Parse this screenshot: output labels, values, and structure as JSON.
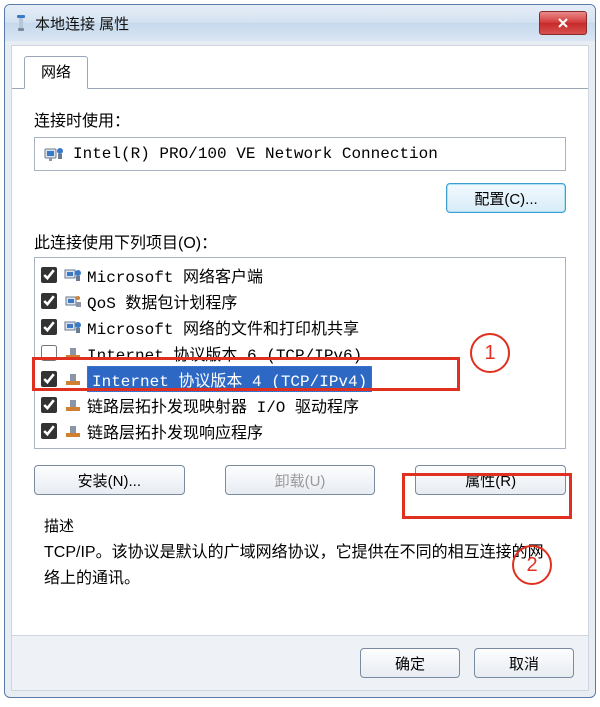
{
  "window": {
    "title": "本地连接 属性",
    "close_label": "X"
  },
  "tab": {
    "label": "网络"
  },
  "adapter": {
    "label": "连接时使用：",
    "name": "Intel(R) PRO/100 VE Network Connection",
    "configure_btn": "配置(C)..."
  },
  "items_label": "此连接使用下列项目(O)：",
  "items": [
    {
      "checked": true,
      "label": "Microsoft 网络客户端",
      "icon": "client-icon"
    },
    {
      "checked": true,
      "label": "QoS 数据包计划程序",
      "icon": "qos-icon"
    },
    {
      "checked": true,
      "label": "Microsoft 网络的文件和打印机共享",
      "icon": "share-icon"
    },
    {
      "checked": false,
      "label": "Internet 协议版本 6 (TCP/IPv6)",
      "icon": "protocol-icon"
    },
    {
      "checked": true,
      "label": "Internet 协议版本 4 (TCP/IPv4)",
      "icon": "protocol-icon",
      "selected": true
    },
    {
      "checked": true,
      "label": "链路层拓扑发现映射器 I/O 驱动程序",
      "icon": "protocol-icon"
    },
    {
      "checked": true,
      "label": "链路层拓扑发现响应程序",
      "icon": "protocol-icon"
    }
  ],
  "buttons": {
    "install": "安装(N)...",
    "uninstall": "卸载(U)",
    "properties": "属性(R)"
  },
  "description": {
    "legend": "描述",
    "text": "TCP/IP。该协议是默认的广域网络协议，它提供在不同的相互连接的网络上的通讯。"
  },
  "dialog_buttons": {
    "ok": "确定",
    "cancel": "取消"
  },
  "annotations": {
    "n1": "1",
    "n2": "2"
  }
}
